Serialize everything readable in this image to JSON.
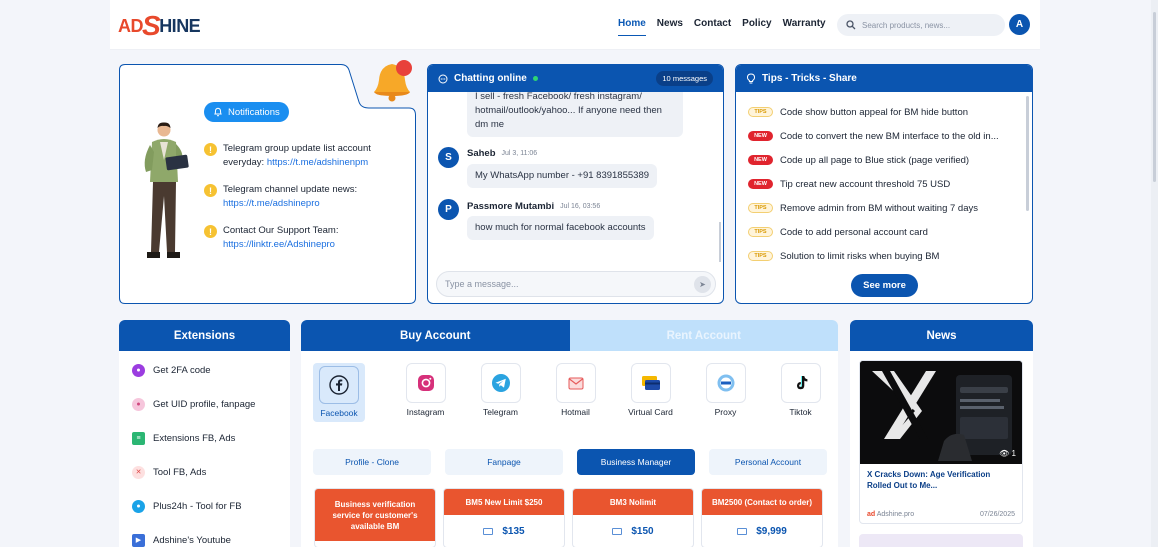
{
  "brand": {
    "logo_ad": "AD",
    "logo_s": "S",
    "logo_hine": "HINE"
  },
  "nav": {
    "items": [
      "Home",
      "News",
      "Contact",
      "Policy",
      "Warranty"
    ],
    "active": "Home"
  },
  "search": {
    "placeholder": "Search products, news..."
  },
  "user": {
    "avatar_letter": "A"
  },
  "notifications": {
    "pill_label": "Notifications",
    "items": [
      {
        "text": "Telegram group update list account everyday: ",
        "link": "https://t.me/adshinenpm"
      },
      {
        "text": "Telegram channel update news: ",
        "link": "https://t.me/adshinepro"
      },
      {
        "text": "Contact Our Support Team: ",
        "link": "https://linktr.ee/Adshinepro"
      }
    ]
  },
  "chat": {
    "title": "Chatting online",
    "count": "10 messages",
    "messages": [
      {
        "text": "I sell - fresh Facebook/ fresh instagram/ hotmail/outlook/yahoo... If anyone need then dm me"
      },
      {
        "user": "Saheb",
        "avatar": "S",
        "time": "Jul 3, 11:06",
        "text": "My WhatsApp number - +91 8391855389"
      },
      {
        "user": "Passmore Mutambi",
        "avatar": "P",
        "time": "Jul 16, 03:56",
        "text": "how much for normal facebook accounts"
      }
    ],
    "input_placeholder": "Type a message..."
  },
  "tips": {
    "title": "Tips - Tricks - Share",
    "items": [
      {
        "badge": "tips",
        "badge_label": "TIPS",
        "text": "Code show button appeal for BM hide button"
      },
      {
        "badge": "new",
        "badge_label": "NEW",
        "text": "Code to convert the new BM interface to the old in..."
      },
      {
        "badge": "new",
        "badge_label": "NEW",
        "text": "Code up all page to Blue stick (page verified)"
      },
      {
        "badge": "new",
        "badge_label": "NEW",
        "text": "Tip creat new account threshold 75 USD"
      },
      {
        "badge": "tips",
        "badge_label": "TIPS",
        "text": "Remove admin from BM without waiting 7 days"
      },
      {
        "badge": "tips",
        "badge_label": "TIPS",
        "text": "Code to add personal account card"
      },
      {
        "badge": "tips",
        "badge_label": "TIPS",
        "text": "Solution to limit risks when buying BM"
      }
    ],
    "see_more": "See more"
  },
  "extensions": {
    "title": "Extensions",
    "items": [
      {
        "label": "Get 2FA code",
        "color": "#9b3de0"
      },
      {
        "label": "Get UID profile, fanpage",
        "color": "#f08ab8"
      },
      {
        "label": "Extensions FB, Ads",
        "color": "#2bb673"
      },
      {
        "label": "Tool FB, Ads",
        "color": "#f06a6a"
      },
      {
        "label": "Plus24h - Tool for FB",
        "color": "#1aa3e8"
      },
      {
        "label": "Adshine's Youtube",
        "color": "#3a6fd8"
      }
    ]
  },
  "shop": {
    "tabs": [
      "Buy Account",
      "Rent Account"
    ],
    "platforms": [
      "Facebook",
      "Instagram",
      "Telegram",
      "Hotmail",
      "Virtual Card",
      "Proxy",
      "Tiktok"
    ],
    "selected_platform": "Facebook",
    "categories": [
      "Profile - Clone",
      "Fanpage",
      "Business Manager",
      "Personal Account"
    ],
    "active_category": "Business Manager",
    "products": [
      {
        "name": "Business verification service for customer's available BM",
        "price": ""
      },
      {
        "name": "BM5 New Limit $250",
        "price": "$135"
      },
      {
        "name": "BM3 Nolimit",
        "price": "$150"
      },
      {
        "name": "BM2500 (Contact to order)",
        "price": "$9,999"
      }
    ]
  },
  "news": {
    "title": "News",
    "card_title": "X Cracks Down: Age Verification Rolled Out to Me...",
    "views": "1",
    "source": "Adshine.pro",
    "date": "07/26/2025"
  }
}
